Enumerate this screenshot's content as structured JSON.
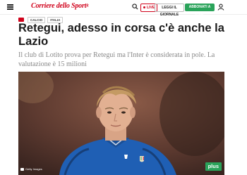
{
  "header": {
    "logo": "Corriere dello Sport",
    "logo_suffix": "it",
    "live_label": "LIVE",
    "read_button": "LEGGI IL GIORNALE",
    "subscribe_button": "ABBONATI A 0,99€"
  },
  "breadcrumb": {
    "items": [
      "CALCIO",
      "ITALIA"
    ]
  },
  "article": {
    "title": "Retegui, adesso in corsa c'è anche la Lazio",
    "subtitle": "Il club di Lotito prova per Retegui ma l'Inter è considerata in pole. La valutazione è 15 milioni"
  },
  "image": {
    "credit": "Getty Images",
    "plus_badge": "plus",
    "jersey_color": "#1f5fb4",
    "background_color": "#6e4638"
  },
  "colors": {
    "brand_red": "#d0021b",
    "accent_green": "#2aa35a"
  }
}
